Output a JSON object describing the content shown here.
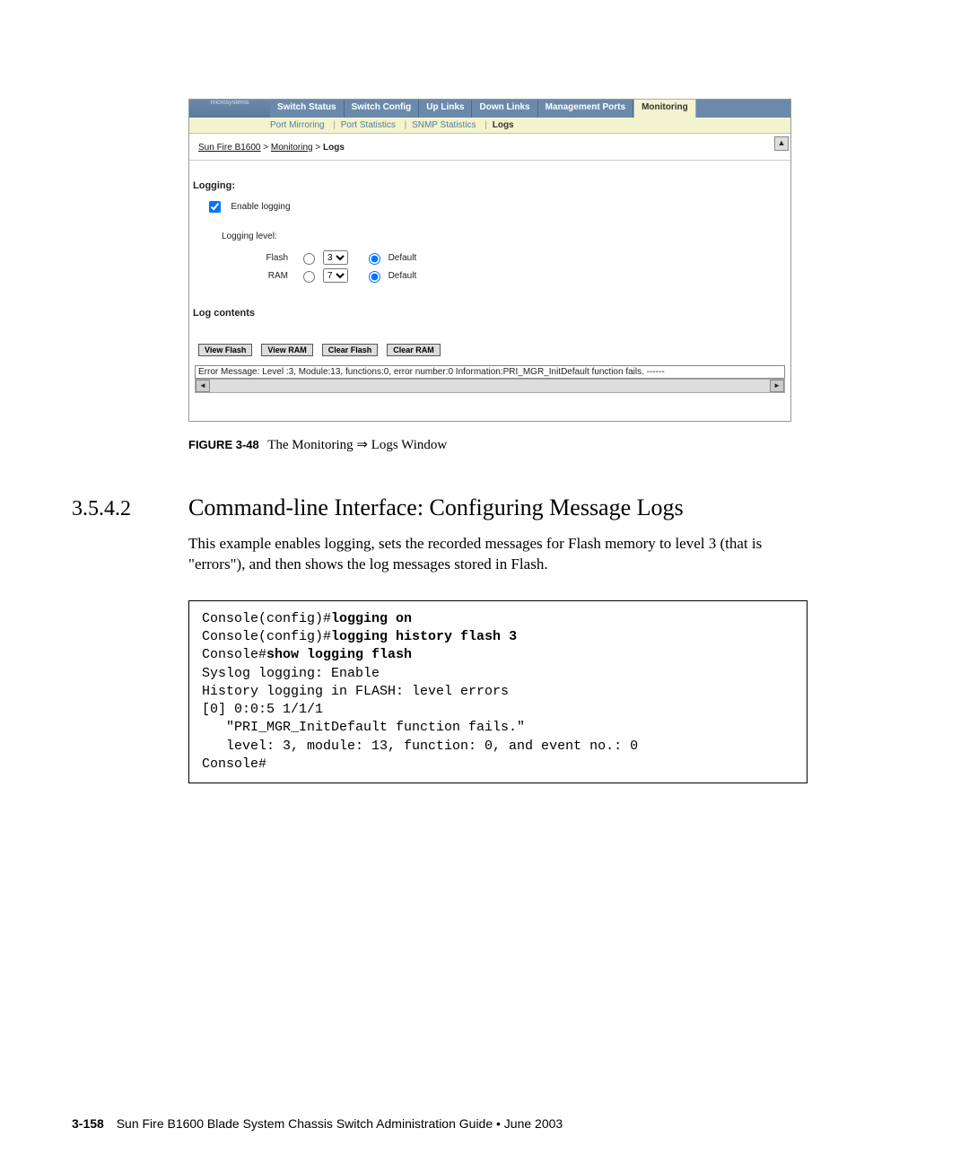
{
  "tabs": {
    "t0": "Switch Status",
    "t1": "Switch Config",
    "t2": "Up Links",
    "t3": "Down Links",
    "t4": "Management Ports",
    "t5": "Monitoring"
  },
  "subnav": {
    "s0": "Port Mirroring",
    "s1": "Port Statistics",
    "s2": "SNMP Statistics",
    "s3": "Logs"
  },
  "crumb": {
    "c0": "Sun Fire B1600",
    "c1": "Monitoring",
    "c2": "Logs"
  },
  "logging_h": "Logging:",
  "enable_label": "Enable logging",
  "level_h": "Logging level:",
  "flash_label": "Flash",
  "ram_label": "RAM",
  "default_label": "Default",
  "flash_val": "3",
  "ram_val": "7",
  "logcontents_h": "Log contents",
  "btns": {
    "b0": "View Flash",
    "b1": "View RAM",
    "b2": "Clear Flash",
    "b3": "Clear RAM"
  },
  "logline": "Error Message: Level :3, Module:13, functions:0, error number:0 Information:PRI_MGR_InitDefault function fails. ------",
  "caption_b": "FIGURE 3-48",
  "caption_t": "The Monitoring ⇒ Logs Window",
  "sec_num": "3.5.4.2",
  "sec_title": "Command-line Interface: Configuring Message Logs",
  "body": "This example enables logging, sets the recorded messages for Flash memory to level 3 (that is \"errors\"), and then shows the log messages stored in Flash.",
  "cli": {
    "p0a": "Console(config)#",
    "p0b": "logging on",
    "p1a": "Console(config)#",
    "p1b": "logging history flash 3",
    "p2a": "Console#",
    "p2b": "show logging flash",
    "l3": "Syslog logging: Enable",
    "l4": "History logging in FLASH: level errors",
    "l5": "[0] 0:0:5 1/1/1",
    "l6": "   \"PRI_MGR_InitDefault function fails.\"",
    "l7": "   level: 3, module: 13, function: 0, and event no.: 0",
    "l8": "Console#"
  },
  "footer_b": "3-158",
  "footer_t": "Sun Fire B1600 Blade System Chassis Switch Administration Guide • June 2003",
  "logo": "microsystems"
}
